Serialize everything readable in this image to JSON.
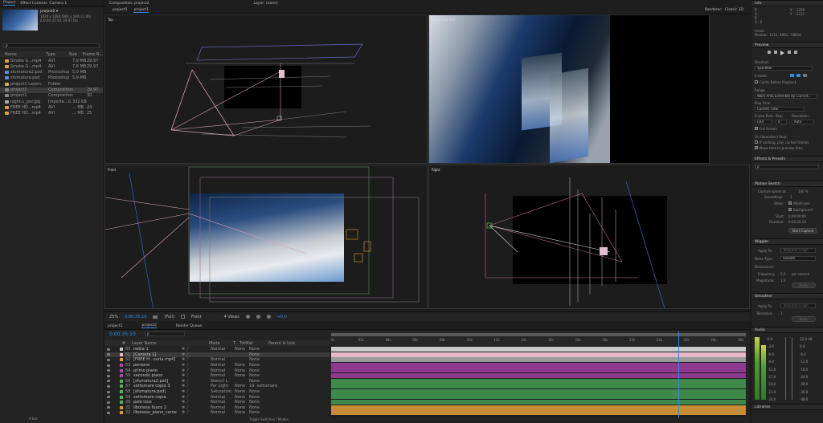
{
  "project_panel": {
    "tabs": [
      "Project",
      "Effect Controls: Camera 1"
    ],
    "selected": {
      "name": "project2 ▾",
      "info1": "1920 x 1080 (960 x 540) (1.00)",
      "info2": "Δ 0:00:35:10, 29.97 fps"
    },
    "search_placeholder": "ρ",
    "columns": [
      "Name",
      "Type",
      "Size",
      "Frame R..."
    ],
    "items": [
      {
        "name": "Smoke G...mp4",
        "type": "AVI",
        "size": "7,9 MB",
        "rate": "29.97",
        "color": "#e8a13a"
      },
      {
        "name": "Smoke G...mp4",
        "type": "AVI",
        "size": "7,6 MB",
        "rate": "29.97",
        "color": "#e8a13a"
      },
      {
        "name": "sfumatura2.psd",
        "type": "Photoshop",
        "size": "5,9 MB",
        "rate": "",
        "color": "#5a8fd6"
      },
      {
        "name": "sfumatura.psd",
        "type": "Photoshop",
        "size": "5,9 MB",
        "rate": "",
        "color": "#5a8fd6"
      },
      {
        "name": "project1 Layers",
        "type": "Folder",
        "size": "",
        "rate": "",
        "color": "#d8b34a"
      },
      {
        "name": "project2",
        "type": "Composition",
        "size": "",
        "rate": "29.97",
        "color": "#8a8a8a"
      },
      {
        "name": "project1",
        "type": "Composition",
        "size": "",
        "rate": "30",
        "color": "#8a8a8a"
      },
      {
        "name": "night-L_per.jpg",
        "type": "Importe...G",
        "size": "332 KB",
        "rate": "",
        "color": "#aaaaaa"
      },
      {
        "name": "FREE HD...mp4",
        "type": "AVI",
        "size": "... MB",
        "rate": "24",
        "color": "#e8a13a"
      },
      {
        "name": "FREE HD...mp4",
        "type": "AVI",
        "size": "... MB",
        "rate": "25",
        "color": "#e8a13a"
      }
    ],
    "footer": "8 bpc"
  },
  "composition_panel": {
    "tabs": [
      "project2",
      "project1"
    ],
    "comp_title": "Composition: project2",
    "layer_title": "Layer: (none)",
    "renderer": "Renderer:",
    "renderer_value": "Classic 3D",
    "views": {
      "top": "Top",
      "active": "Active Camera",
      "front": "Front",
      "right": "Right"
    },
    "bottom_bar": {
      "zoom": "25%",
      "timecode": "0:00:35:10",
      "resolution": "(Full)",
      "view": "Front",
      "layout": "4 Views",
      "exposure": "+0,0"
    }
  },
  "timeline_panel": {
    "tabs": [
      "project1",
      "project2",
      "Render Queue"
    ],
    "timecode": "0:00:35:10",
    "search_placeholder": "ρ",
    "columns": [
      "#",
      "Layer Name",
      "Mode",
      "T",
      "TrkMat",
      "Parent & Link"
    ],
    "ruler": [
      "0s",
      "02s",
      "04s",
      "06s",
      "08s",
      "10s",
      "12s",
      "14s",
      "16s",
      "18s",
      "20s",
      "22s",
      "24s",
      "26s",
      "28s",
      "30s"
    ],
    "layers": [
      {
        "num": "60",
        "name": "nebia 1",
        "mode": "Normal",
        "trk": "None",
        "parent": "None",
        "label": "#c8c8c8",
        "bar": "#c8c8c8"
      },
      {
        "num": "51",
        "name": "[Camera 1]",
        "mode": "",
        "trk": "",
        "parent": "None",
        "label": "#e8b8c8",
        "bar": "#e6b8c7"
      },
      {
        "num": "52",
        "name": "[FREE H...ouria.mp4]",
        "mode": "Normal",
        "trk": "",
        "parent": "None",
        "label": "#e8a13a",
        "bar": "#9a9a9a"
      },
      {
        "num": "53",
        "name": "persone",
        "mode": "Normal",
        "trk": "None",
        "parent": "None",
        "label": "#b04aa8",
        "bar": "#8e3a8e"
      },
      {
        "num": "54",
        "name": "primo piano",
        "mode": "Normal",
        "trk": "None",
        "parent": "None",
        "label": "#b04aa8",
        "bar": "#8e3a8e"
      },
      {
        "num": "55",
        "name": "secondo piano",
        "mode": "Normal",
        "trk": "None",
        "parent": "None",
        "label": "#b04aa8",
        "bar": "#8e3a8e"
      },
      {
        "num": "56",
        "name": "[sfumatura2.psd]",
        "mode": "Stencil L",
        "trk": "",
        "parent": "None",
        "label": "#5ab05a",
        "bar": "#3f8a4a"
      },
      {
        "num": "57",
        "name": "sottomare copia 3",
        "mode": "Per Light",
        "trk": "None",
        "parent": "19. sottomare",
        "label": "#5ab05a",
        "bar": "#3f8a4a"
      },
      {
        "num": "58",
        "name": "[sfumatura.psd]",
        "mode": "Saturation",
        "trk": "None",
        "parent": "None",
        "label": "#5ab05a",
        "bar": "#3f8a4a"
      },
      {
        "num": "59",
        "name": "sottomare copia",
        "mode": "Normal",
        "trk": "None",
        "parent": "None",
        "label": "#5ab05a",
        "bar": "#3f8a4a"
      },
      {
        "num": "20",
        "name": "pale luce",
        "mode": "Normal",
        "trk": "None",
        "parent": "None",
        "label": "#5ab05a",
        "bar": "#3f8a4a"
      },
      {
        "num": "21",
        "name": "ilbonese fuoco 2",
        "mode": "Normal",
        "trk": "None",
        "parent": "None",
        "label": "#d69a3a",
        "bar": "#c78d35"
      },
      {
        "num": "22",
        "name": "ilbonese_piano_carne",
        "mode": "Normal",
        "trk": "None",
        "parent": "None",
        "label": "#d69a3a",
        "bar": "#c78d35"
      }
    ],
    "footer": "Toggle Switches / Modes"
  },
  "info_panel": {
    "title": "Info",
    "r": "R :",
    "g": "G :",
    "b": "B :",
    "a": "A : 0",
    "x": "X : -1299",
    "y": "Y : -1213",
    "layer_name": "Vision",
    "position": "Position: 1512, 3802, -59910"
  },
  "preview_panel": {
    "title": "Preview",
    "shortcut_label": "Shortcut",
    "shortcut_value": "Spacebar",
    "include_label": "Include:",
    "cache_label": "Cache Before Playback",
    "range_label": "Range",
    "range_value": "Work Area Extended By Current...",
    "play_from_label": "Play From",
    "play_from_value": "Current Time",
    "frame_rate_label": "Frame Rate",
    "skip_label": "Skip",
    "resolution_label": "Resolution",
    "frame_rate_value": "(30)",
    "skip_value": "0",
    "resolution_value": "Auto",
    "full_screen": "Full Screen",
    "stop_label": "On (Spacebar) Stop:",
    "if_caching": "If caching, play cached frames",
    "move_time": "Move time to preview time"
  },
  "effects_panel": {
    "title": "Effects & Presets",
    "search_placeholder": "ρ"
  },
  "motion_sketch": {
    "title": "Motion Sketch",
    "capture_label": "Capture speed at:",
    "capture_value": "100 %",
    "smoothing_label": "Smoothing:",
    "smoothing_value": "1",
    "show_label": "Show:",
    "wireframe": "Wireframe",
    "background": "Background",
    "start_label": "Start:",
    "start_value": "0:00:00:00",
    "duration_label": "Duration:",
    "duration_value": "0:00:35:10",
    "button": "Start Capture"
  },
  "wiggler": {
    "title": "Wiggler",
    "apply_label": "Apply To:",
    "apply_value": "Temporal Graph",
    "noise_label": "Noise Type:",
    "noise_value": "Smooth",
    "dimensions_label": "Dimensions:",
    "frequency_label": "Frequency:",
    "frequency_value": "5.0",
    "per_second": "per second",
    "magnitude_label": "Magnitude:",
    "magnitude_value": "1.0",
    "button": "Apply"
  },
  "smoother": {
    "title": "Smoother",
    "apply_label": "Apply To:",
    "apply_value": "Temporal Graph",
    "tolerance_label": "Tolerance:",
    "tolerance_value": "1",
    "button": "Apply"
  },
  "audio_panel": {
    "title": "Audio",
    "left_scale": [
      "0.0",
      "-3.0",
      "-6.0",
      "-9.0",
      "-12.0",
      "-15.0",
      "-18.0",
      "-21.0",
      "-24.0"
    ],
    "right_scale": [
      "12.0 dB",
      "0.0",
      "-6.0",
      "-12.0",
      "-18.0",
      "-24.0",
      "-30.0",
      "-36.0",
      "-48.0"
    ]
  },
  "libraries_panel": {
    "title": "Libraries"
  }
}
